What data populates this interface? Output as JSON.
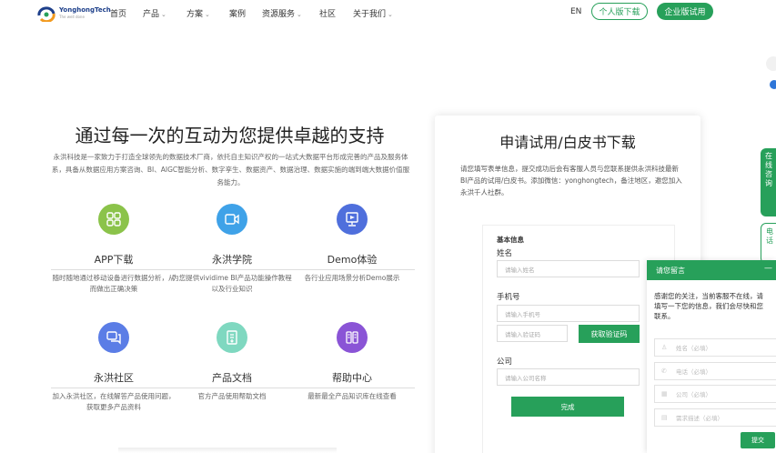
{
  "nav": {
    "logo_text": "YonghongTech",
    "logo_sub": "The well done",
    "items": [
      {
        "label": "首页",
        "dropdown": false
      },
      {
        "label": "产品",
        "dropdown": true
      },
      {
        "label": "方案",
        "dropdown": true
      },
      {
        "label": "案例",
        "dropdown": false
      },
      {
        "label": "资源服务",
        "dropdown": true
      },
      {
        "label": "社区",
        "dropdown": false
      },
      {
        "label": "关于我们",
        "dropdown": true
      }
    ],
    "lang": "EN",
    "personal_download": "个人版下载",
    "enterprise_trial": "企业版试用"
  },
  "hero": {
    "headline": "通过每一次的互动为您提供卓越的支持",
    "intro": "永洪科技是一家致力于打造全球领先的数据技术厂商，依托自主知识产权的一站式大数据平台形成完善的产品及服务体系，具备从数据应用方案咨询、BI、AIGC智能分析、数字孪生、数据资产、数据治理、数据实施的端到端大数据价值服务能力。"
  },
  "features": [
    {
      "title": "APP下载",
      "desc": "随时随地通过移动设备进行数据分析，从而做出正确决策",
      "icon": "grid-icon",
      "color": "#8bc34a"
    },
    {
      "title": "永洪学院",
      "desc": "为您提供vividime BI产品功能操作教程以及行业知识",
      "icon": "video-icon",
      "color": "#3fa2e8"
    },
    {
      "title": "Demo体验",
      "desc": "各行业应用场景分析Demo展示",
      "icon": "presentation-icon",
      "color": "#4f6fdc"
    },
    {
      "title": "永洪社区",
      "desc": "加入永洪社区，在线解答产品使用问题，获取更多产品资料",
      "icon": "chat-icon",
      "color": "#5b7de6"
    },
    {
      "title": "产品文档",
      "desc": "官方产品使用帮助文档",
      "icon": "document-icon",
      "color": "#7fd8c0"
    },
    {
      "title": "帮助中心",
      "desc": "最新最全产品知识库在线查看",
      "icon": "help-grid-icon",
      "color": "#8a54d6"
    }
  ],
  "form": {
    "title": "申请试用/白皮书下载",
    "desc": "请您填写表单信息，提交成功后会有客服人员与您联系提供永洪科技最新BI产品的试用/白皮书。添加微信：yonghongtech，备注地区，邀您加入永洪千人社群。",
    "section_basic": "基本信息",
    "name_label": "姓名",
    "name_placeholder": "请输入姓名",
    "phone_label": "手机号",
    "phone_placeholder": "请输入手机号",
    "code_placeholder": "请输入验证码",
    "code_button": "获取验证码",
    "company_label": "公司",
    "company_placeholder": "请输入公司名称",
    "submit": "完成"
  },
  "chat": {
    "title": "请您留言",
    "minimize": "—",
    "message": "感谢您的关注，当前客服不在线，请填写一下您的信息，我们会尽快和您联系。",
    "fields": [
      {
        "icon": "user-icon",
        "glyph": "♙",
        "placeholder": "姓名（必填）"
      },
      {
        "icon": "phone-icon",
        "glyph": "✆",
        "placeholder": "电话（必填）"
      },
      {
        "icon": "company-icon",
        "glyph": "▦",
        "placeholder": "公司（必填）"
      },
      {
        "icon": "note-icon",
        "glyph": "▤",
        "placeholder": "需求描述（必填）"
      }
    ],
    "submit": "提交"
  },
  "edge": {
    "tab1": "在线咨询",
    "tab2": "电话"
  },
  "colors": {
    "brand_green": "#27a05a"
  }
}
